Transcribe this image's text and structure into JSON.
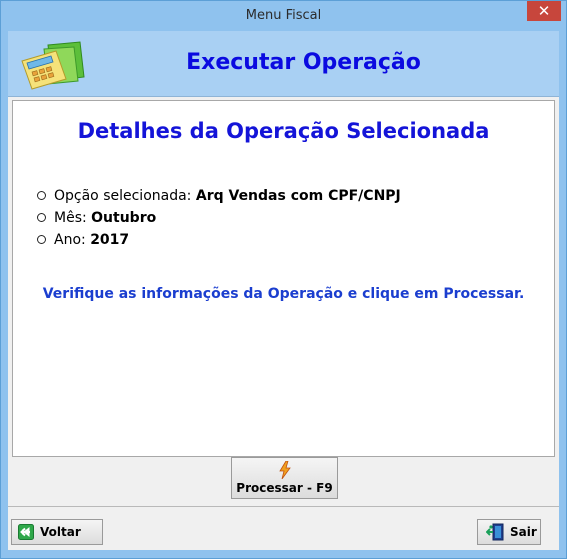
{
  "window": {
    "title": "Menu Fiscal",
    "close_glyph": "✕"
  },
  "header": {
    "title": "Executar Operação",
    "logo_icon": "calculator-folder-icon"
  },
  "content": {
    "title": "Detalhes da Operação Selecionada",
    "items": [
      {
        "label": "Opção selecionada:",
        "value": "Arq Vendas com CPF/CNPJ"
      },
      {
        "label": "Mês:",
        "value": "Outubro"
      },
      {
        "label": "Ano:",
        "value": "2017"
      }
    ],
    "notice": "Verifique as informações da Operação e clique em Processar."
  },
  "buttons": {
    "processar": {
      "label": "Processar - F9",
      "icon": "lightning-icon"
    },
    "voltar": {
      "label": "Voltar",
      "icon": "back-arrow-icon"
    },
    "sair": {
      "label": "Sair",
      "icon": "exit-door-icon"
    }
  },
  "colors": {
    "accent": "#0a0ae0",
    "titlebar": "#8fc2ee",
    "header_band": "#a9d0f3",
    "close": "#c7463c"
  }
}
